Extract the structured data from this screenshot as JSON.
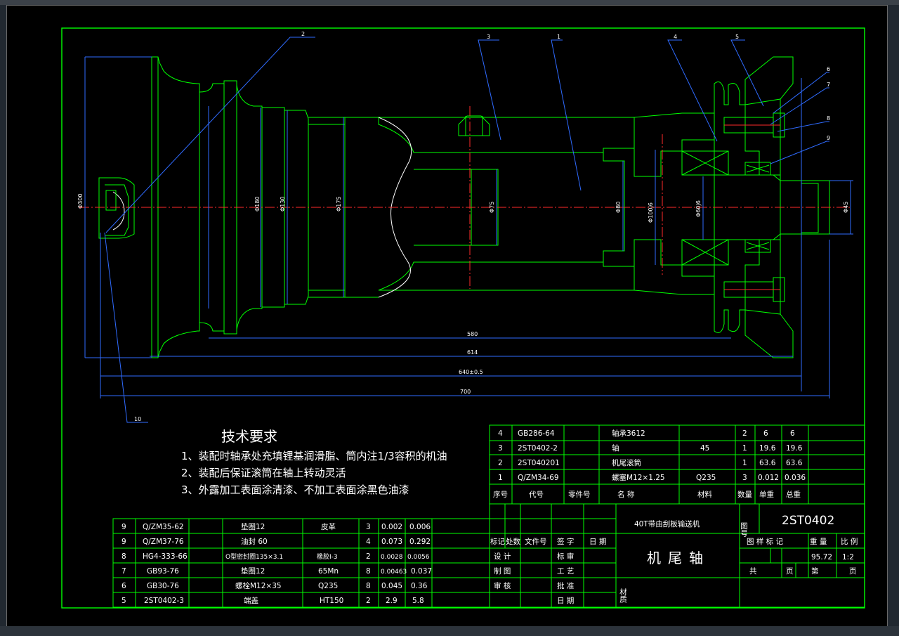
{
  "tech": {
    "title": "技术要求",
    "items": [
      "1、装配时轴承处充填锂基润滑脂、筒内注1/3容积的机油",
      "2、装配后保证滚筒在轴上转动灵活",
      "3、外露加工表面涂清漆、不加工表面涂黑色油漆"
    ]
  },
  "dims": {
    "d1": "Φ300",
    "d2": "Φ180",
    "d3": "Φ130",
    "d4": "Φ175",
    "d5": "Φ75",
    "d6": "Φ80",
    "d7": "Φ100j6",
    "d8": "Φ60j6",
    "d9": "Φ45",
    "l1": "580",
    "l2": "614",
    "l3": "640±0.5",
    "l4": "700"
  },
  "balloons": [
    "1",
    "2",
    "3",
    "4",
    "5",
    "6",
    "7",
    "8",
    "9",
    "10"
  ],
  "bom_upper": {
    "rows": [
      [
        "4",
        "GB286-64",
        "",
        "轴承3612",
        "",
        "2",
        "6",
        "6"
      ],
      [
        "3",
        "2ST0402-2",
        "",
        "轴",
        "45",
        "1",
        "19.6",
        "19.6"
      ],
      [
        "2",
        "2ST040201",
        "",
        "机尾滚筒",
        "",
        "1",
        "63.6",
        "63.6"
      ],
      [
        "1",
        "Q/ZM34-69",
        "",
        "螺塞M12×1.25",
        "Q235",
        "3",
        "0.012",
        "0.036"
      ]
    ],
    "header": [
      "序号",
      "代号",
      "零件号",
      "名  称",
      "材料",
      "数量",
      "单重",
      "总重"
    ]
  },
  "bom_lower": {
    "rows": [
      [
        "9",
        "Q/ZM35-62",
        "",
        "垫圈12",
        "皮革",
        "3",
        "0.002",
        "0.006"
      ],
      [
        "9",
        "Q/ZM37-76",
        "",
        "油封 60",
        "",
        "4",
        "0.073",
        "0.292"
      ],
      [
        "8",
        "HG4-333-66",
        "",
        "O型密封圈135×3.1",
        "橡胶I-3",
        "2",
        "0.0028",
        "0.0056"
      ],
      [
        "7",
        "GB93-76",
        "",
        "垫圈12",
        "65Mn",
        "8",
        "0.00463",
        "0.037"
      ],
      [
        "6",
        "GB30-76",
        "",
        "螺栓M12×35",
        "Q235",
        "8",
        "0.045",
        "0.36"
      ],
      [
        "5",
        "2ST0402-3",
        "",
        "端盖",
        "HT150",
        "2",
        "2.9",
        "5.8"
      ]
    ]
  },
  "title_block": {
    "project": "40T带由刮板输送机",
    "fig_label": "图号",
    "drawing_no": "2ST0402",
    "part_name": "机尾轴",
    "rev_headers": [
      "标记",
      "处数",
      "文件号",
      "签 字",
      "日 期"
    ],
    "roles_left": [
      "设 计",
      "制 图",
      "审 核"
    ],
    "roles_right": [
      "标 审",
      "工 艺",
      "批 准",
      "日 期"
    ],
    "material_label": "材质",
    "stage_headers": [
      "图 样 标 记",
      "重 量",
      "比 例"
    ],
    "weight": "95.72",
    "scale": "1:2",
    "sheet": [
      "共",
      "页",
      "第",
      "页"
    ]
  }
}
